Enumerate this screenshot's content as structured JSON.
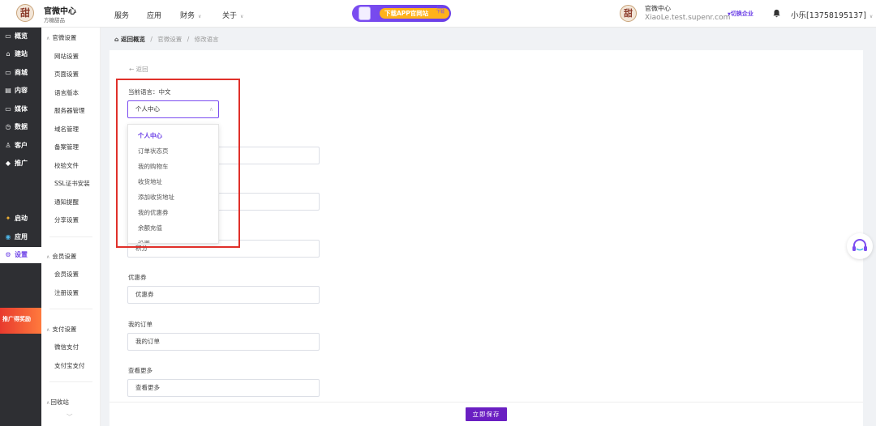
{
  "brand": {
    "name": "官微中心",
    "sub": "方糖甜品",
    "logo_char": "甜"
  },
  "topnav": [
    {
      "label": "服务"
    },
    {
      "label": "应用"
    },
    {
      "label": "财务"
    },
    {
      "label": "关于"
    }
  ],
  "promo": {
    "label": "下载APP官网站",
    "qr": "扫码下载"
  },
  "account": {
    "logo_char": "甜",
    "name": "官微中心",
    "domain": "XiaoLe.test.supenr.com",
    "switch": "切换企业",
    "user": "小乐[13758195137]"
  },
  "sidebar": [
    {
      "label": "概览",
      "icon": "▭"
    },
    {
      "label": "建站",
      "icon": "⌂"
    },
    {
      "label": "商城",
      "icon": "▭"
    },
    {
      "label": "内容",
      "icon": "▤"
    },
    {
      "label": "媒体",
      "icon": "▭"
    },
    {
      "label": "数据",
      "icon": "◷"
    },
    {
      "label": "客户",
      "icon": "♙"
    },
    {
      "label": "推广",
      "icon": "◆"
    },
    {
      "label": "启动",
      "icon": "✦"
    },
    {
      "label": "应用",
      "icon": "◉"
    },
    {
      "label": "设置",
      "icon": "⚙"
    }
  ],
  "sidebar_promo": "推广得奖励",
  "subnav": {
    "group1": "官微设置",
    "items1": [
      "网站设置",
      "页面设置",
      "语言版本",
      "服务器管理",
      "域名管理",
      "备案管理",
      "校验文件",
      "SSL证书安装",
      "通知提醒",
      "分享设置"
    ],
    "group2": "会员设置",
    "items2": [
      "会员设置",
      "注册设置"
    ],
    "group3": "支付设置",
    "items3": [
      "微信支付",
      "支付宝支付"
    ],
    "group4": "回收站"
  },
  "breadcrumb": {
    "home": "返回概览",
    "sep": "/",
    "level1": "官微设置",
    "level2": "修改语言"
  },
  "back": "← 返回",
  "current_language": "当前语言：中文",
  "select": {
    "value": "个人中心"
  },
  "dropdown_options": [
    "个人中心",
    "订单状态页",
    "我的购物车",
    "收货地址",
    "添加收货地址",
    "我的优惠券",
    "余额充值",
    "设置"
  ],
  "fields": {
    "f1": {
      "value": ""
    },
    "f2": {
      "value": ""
    },
    "points": {
      "value": "积分"
    },
    "coupon": {
      "label": "优惠券",
      "value": "优惠券"
    },
    "orders": {
      "label": "我的订单",
      "value": "我的订单"
    },
    "more": {
      "label": "查看更多",
      "value": "查看更多"
    }
  },
  "save_button": "立即保存",
  "colors": {
    "accent": "#6a3ee6",
    "highlight": "#e0302a"
  }
}
